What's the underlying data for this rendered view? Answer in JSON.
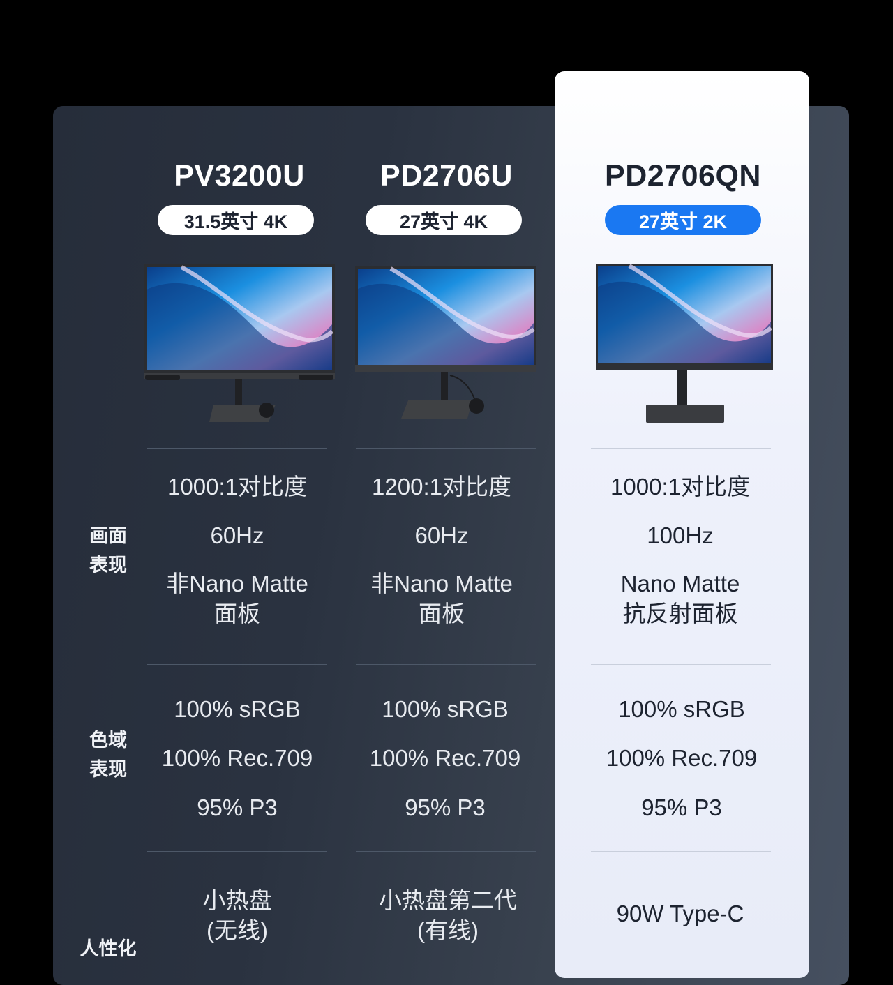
{
  "columns": [
    {
      "model": "PV3200U",
      "size_badge": "31.5英寸 4K",
      "display": {
        "contrast": "1000:1对比度",
        "refresh": "60Hz",
        "panel_line1": "非Nano Matte",
        "panel_line2": "面板"
      },
      "color": {
        "srgb": "100% sRGB",
        "rec709": "100% Rec.709",
        "p3": "95% P3"
      },
      "extra": {
        "line1": "小热盘",
        "line2": "(无线)"
      }
    },
    {
      "model": "PD2706U",
      "size_badge": "27英寸 4K",
      "display": {
        "contrast": "1200:1对比度",
        "refresh": "60Hz",
        "panel_line1": "非Nano Matte",
        "panel_line2": "面板"
      },
      "color": {
        "srgb": "100% sRGB",
        "rec709": "100% Rec.709",
        "p3": "95% P3"
      },
      "extra": {
        "line1": "小热盘第二代",
        "line2": "(有线)"
      }
    },
    {
      "model": "PD2706QN",
      "size_badge": "27英寸 2K",
      "display": {
        "contrast": "1000:1对比度",
        "refresh": "100Hz",
        "panel_line1": "Nano Matte",
        "panel_line2": "抗反射面板"
      },
      "color": {
        "srgb": "100% sRGB",
        "rec709": "100% Rec.709",
        "p3": "95% P3"
      },
      "extra": {
        "line1": "90W Type-C"
      }
    }
  ],
  "row_labels": {
    "display_line1": "画面",
    "display_line2": "表现",
    "color_line1": "色域",
    "color_line2": "表现",
    "extra_partial": "人性化"
  },
  "colors": {
    "badge_blue": "#1a78f2",
    "panel_dark": "#2a3240",
    "highlight_bg": "#eef1fb"
  },
  "icons": [
    "monitor-image",
    "puck-controller"
  ]
}
